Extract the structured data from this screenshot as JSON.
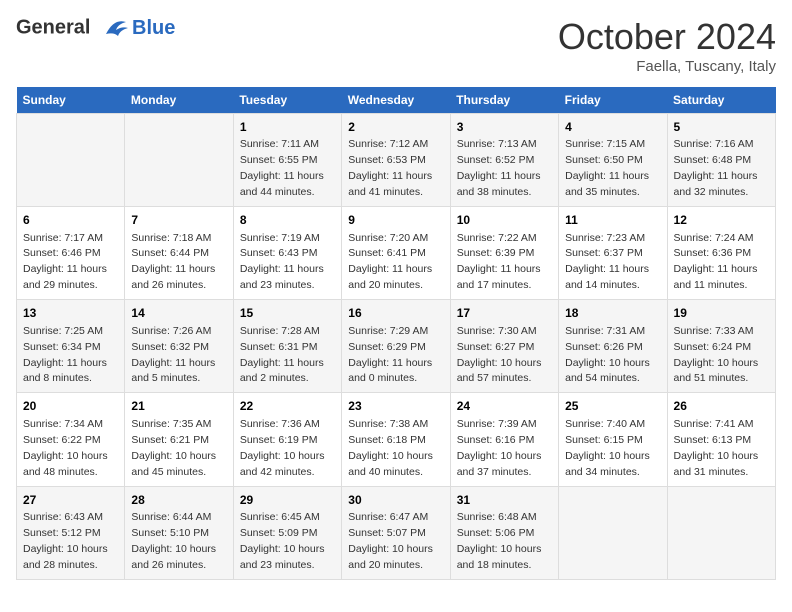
{
  "header": {
    "logo_line1": "General",
    "logo_line2": "Blue",
    "month": "October 2024",
    "location": "Faella, Tuscany, Italy"
  },
  "days_of_week": [
    "Sunday",
    "Monday",
    "Tuesday",
    "Wednesday",
    "Thursday",
    "Friday",
    "Saturday"
  ],
  "weeks": [
    [
      {
        "day": "",
        "sunrise": "",
        "sunset": "",
        "daylight": ""
      },
      {
        "day": "",
        "sunrise": "",
        "sunset": "",
        "daylight": ""
      },
      {
        "day": "1",
        "sunrise": "Sunrise: 7:11 AM",
        "sunset": "Sunset: 6:55 PM",
        "daylight": "Daylight: 11 hours and 44 minutes."
      },
      {
        "day": "2",
        "sunrise": "Sunrise: 7:12 AM",
        "sunset": "Sunset: 6:53 PM",
        "daylight": "Daylight: 11 hours and 41 minutes."
      },
      {
        "day": "3",
        "sunrise": "Sunrise: 7:13 AM",
        "sunset": "Sunset: 6:52 PM",
        "daylight": "Daylight: 11 hours and 38 minutes."
      },
      {
        "day": "4",
        "sunrise": "Sunrise: 7:15 AM",
        "sunset": "Sunset: 6:50 PM",
        "daylight": "Daylight: 11 hours and 35 minutes."
      },
      {
        "day": "5",
        "sunrise": "Sunrise: 7:16 AM",
        "sunset": "Sunset: 6:48 PM",
        "daylight": "Daylight: 11 hours and 32 minutes."
      }
    ],
    [
      {
        "day": "6",
        "sunrise": "Sunrise: 7:17 AM",
        "sunset": "Sunset: 6:46 PM",
        "daylight": "Daylight: 11 hours and 29 minutes."
      },
      {
        "day": "7",
        "sunrise": "Sunrise: 7:18 AM",
        "sunset": "Sunset: 6:44 PM",
        "daylight": "Daylight: 11 hours and 26 minutes."
      },
      {
        "day": "8",
        "sunrise": "Sunrise: 7:19 AM",
        "sunset": "Sunset: 6:43 PM",
        "daylight": "Daylight: 11 hours and 23 minutes."
      },
      {
        "day": "9",
        "sunrise": "Sunrise: 7:20 AM",
        "sunset": "Sunset: 6:41 PM",
        "daylight": "Daylight: 11 hours and 20 minutes."
      },
      {
        "day": "10",
        "sunrise": "Sunrise: 7:22 AM",
        "sunset": "Sunset: 6:39 PM",
        "daylight": "Daylight: 11 hours and 17 minutes."
      },
      {
        "day": "11",
        "sunrise": "Sunrise: 7:23 AM",
        "sunset": "Sunset: 6:37 PM",
        "daylight": "Daylight: 11 hours and 14 minutes."
      },
      {
        "day": "12",
        "sunrise": "Sunrise: 7:24 AM",
        "sunset": "Sunset: 6:36 PM",
        "daylight": "Daylight: 11 hours and 11 minutes."
      }
    ],
    [
      {
        "day": "13",
        "sunrise": "Sunrise: 7:25 AM",
        "sunset": "Sunset: 6:34 PM",
        "daylight": "Daylight: 11 hours and 8 minutes."
      },
      {
        "day": "14",
        "sunrise": "Sunrise: 7:26 AM",
        "sunset": "Sunset: 6:32 PM",
        "daylight": "Daylight: 11 hours and 5 minutes."
      },
      {
        "day": "15",
        "sunrise": "Sunrise: 7:28 AM",
        "sunset": "Sunset: 6:31 PM",
        "daylight": "Daylight: 11 hours and 2 minutes."
      },
      {
        "day": "16",
        "sunrise": "Sunrise: 7:29 AM",
        "sunset": "Sunset: 6:29 PM",
        "daylight": "Daylight: 11 hours and 0 minutes."
      },
      {
        "day": "17",
        "sunrise": "Sunrise: 7:30 AM",
        "sunset": "Sunset: 6:27 PM",
        "daylight": "Daylight: 10 hours and 57 minutes."
      },
      {
        "day": "18",
        "sunrise": "Sunrise: 7:31 AM",
        "sunset": "Sunset: 6:26 PM",
        "daylight": "Daylight: 10 hours and 54 minutes."
      },
      {
        "day": "19",
        "sunrise": "Sunrise: 7:33 AM",
        "sunset": "Sunset: 6:24 PM",
        "daylight": "Daylight: 10 hours and 51 minutes."
      }
    ],
    [
      {
        "day": "20",
        "sunrise": "Sunrise: 7:34 AM",
        "sunset": "Sunset: 6:22 PM",
        "daylight": "Daylight: 10 hours and 48 minutes."
      },
      {
        "day": "21",
        "sunrise": "Sunrise: 7:35 AM",
        "sunset": "Sunset: 6:21 PM",
        "daylight": "Daylight: 10 hours and 45 minutes."
      },
      {
        "day": "22",
        "sunrise": "Sunrise: 7:36 AM",
        "sunset": "Sunset: 6:19 PM",
        "daylight": "Daylight: 10 hours and 42 minutes."
      },
      {
        "day": "23",
        "sunrise": "Sunrise: 7:38 AM",
        "sunset": "Sunset: 6:18 PM",
        "daylight": "Daylight: 10 hours and 40 minutes."
      },
      {
        "day": "24",
        "sunrise": "Sunrise: 7:39 AM",
        "sunset": "Sunset: 6:16 PM",
        "daylight": "Daylight: 10 hours and 37 minutes."
      },
      {
        "day": "25",
        "sunrise": "Sunrise: 7:40 AM",
        "sunset": "Sunset: 6:15 PM",
        "daylight": "Daylight: 10 hours and 34 minutes."
      },
      {
        "day": "26",
        "sunrise": "Sunrise: 7:41 AM",
        "sunset": "Sunset: 6:13 PM",
        "daylight": "Daylight: 10 hours and 31 minutes."
      }
    ],
    [
      {
        "day": "27",
        "sunrise": "Sunrise: 6:43 AM",
        "sunset": "Sunset: 5:12 PM",
        "daylight": "Daylight: 10 hours and 28 minutes."
      },
      {
        "day": "28",
        "sunrise": "Sunrise: 6:44 AM",
        "sunset": "Sunset: 5:10 PM",
        "daylight": "Daylight: 10 hours and 26 minutes."
      },
      {
        "day": "29",
        "sunrise": "Sunrise: 6:45 AM",
        "sunset": "Sunset: 5:09 PM",
        "daylight": "Daylight: 10 hours and 23 minutes."
      },
      {
        "day": "30",
        "sunrise": "Sunrise: 6:47 AM",
        "sunset": "Sunset: 5:07 PM",
        "daylight": "Daylight: 10 hours and 20 minutes."
      },
      {
        "day": "31",
        "sunrise": "Sunrise: 6:48 AM",
        "sunset": "Sunset: 5:06 PM",
        "daylight": "Daylight: 10 hours and 18 minutes."
      },
      {
        "day": "",
        "sunrise": "",
        "sunset": "",
        "daylight": ""
      },
      {
        "day": "",
        "sunrise": "",
        "sunset": "",
        "daylight": ""
      }
    ]
  ]
}
